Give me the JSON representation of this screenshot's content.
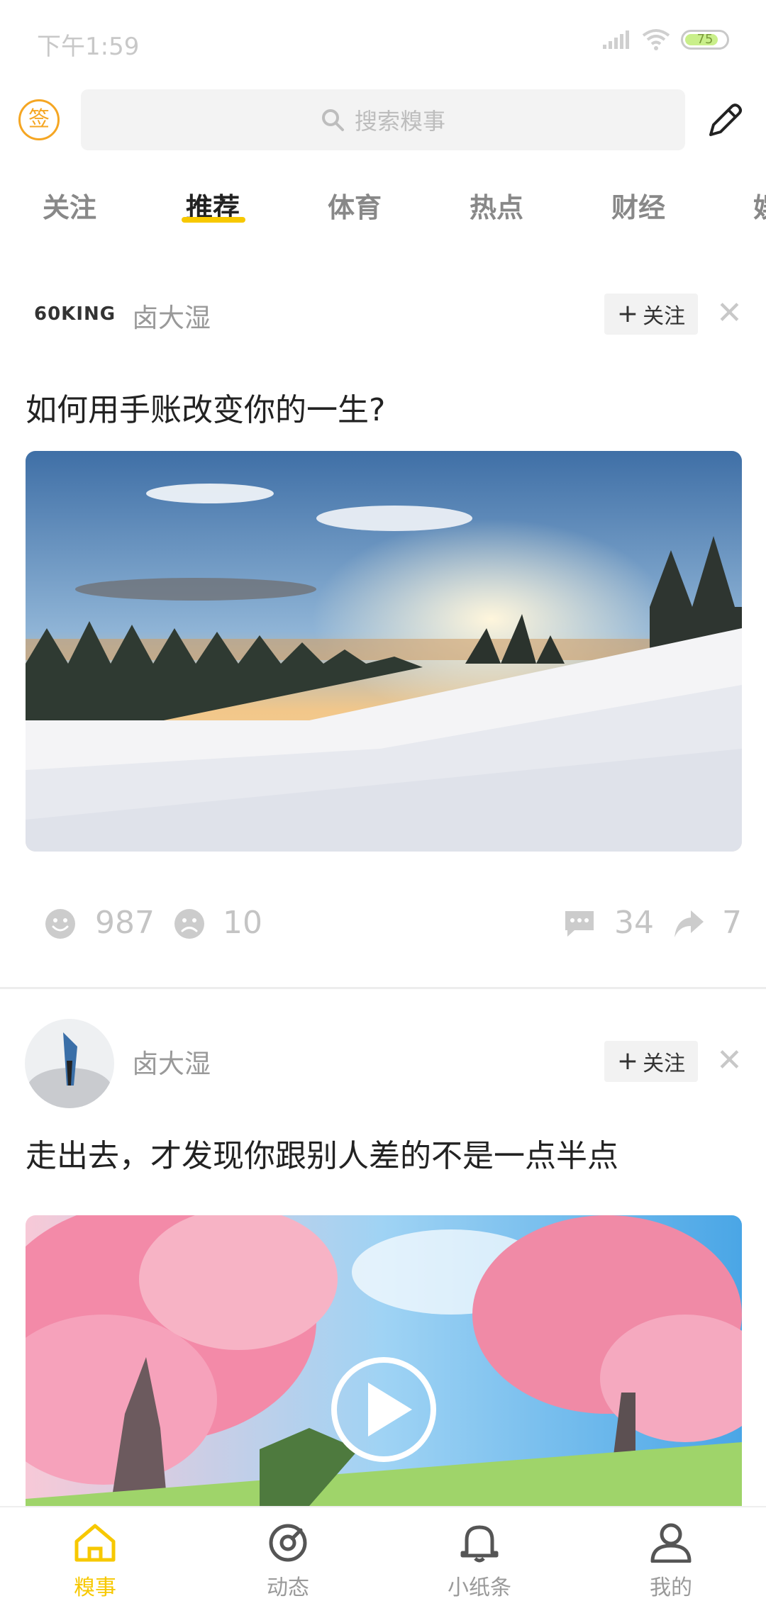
{
  "status_bar": {
    "time": "下午1:59",
    "battery": "75"
  },
  "header": {
    "sign_label": "签",
    "search_placeholder": "搜索糗事"
  },
  "tabs": [
    {
      "label": "关注"
    },
    {
      "label": "推荐"
    },
    {
      "label": "体育"
    },
    {
      "label": "热点"
    },
    {
      "label": "财经"
    },
    {
      "label": "娱"
    }
  ],
  "posts": [
    {
      "avatar_text": "60KING",
      "author": "卤大湿",
      "follow_label": "关注",
      "title": "如何用手账改变你的一生?",
      "likes": "987",
      "dislikes": "10",
      "comments": "34",
      "shares": "7"
    },
    {
      "author": "卤大湿",
      "follow_label": "关注",
      "title": "走出去，才发现你跟别人差的不是一点半点"
    }
  ],
  "bottom_nav": [
    {
      "label": "糗事"
    },
    {
      "label": "动态"
    },
    {
      "label": "小纸条"
    },
    {
      "label": "我的"
    }
  ],
  "colors": {
    "accent": "#f7c800",
    "sign": "#f5a623"
  }
}
